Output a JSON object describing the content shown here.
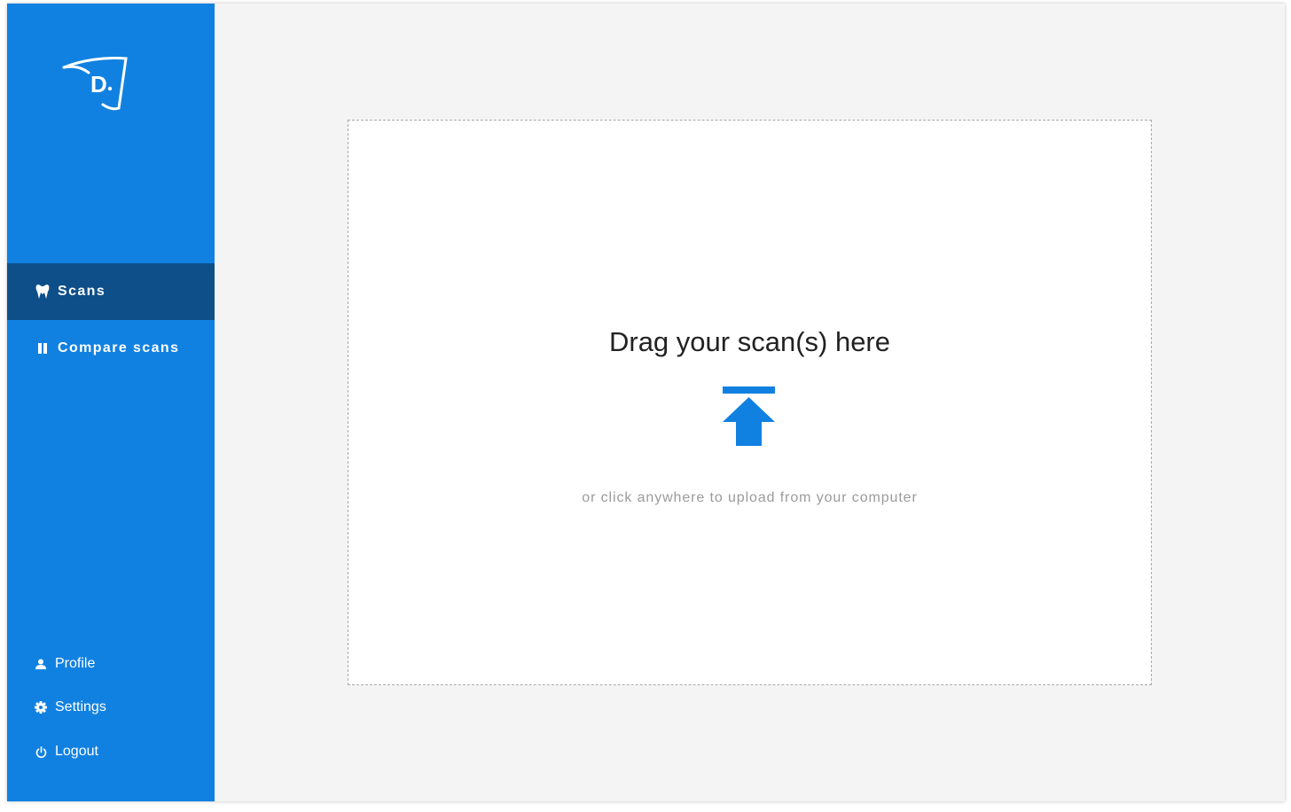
{
  "colors": {
    "sidebar_bg": "#1181e1",
    "sidebar_active": "#0e4f89",
    "accent": "#1181e1",
    "content_bg": "#f4f4f4"
  },
  "sidebar": {
    "logo": "D",
    "nav": [
      {
        "label": "Scans",
        "icon": "tooth-icon",
        "active": true
      },
      {
        "label": "Compare scans",
        "icon": "columns-icon",
        "active": false
      }
    ],
    "bottom": [
      {
        "label": "Profile",
        "icon": "person-icon"
      },
      {
        "label": "Settings",
        "icon": "gear-icon"
      },
      {
        "label": "Logout",
        "icon": "power-icon"
      }
    ]
  },
  "dropzone": {
    "title": "Drag your scan(s) here",
    "subtitle": "or click anywhere to upload from your computer",
    "icon": "upload-icon"
  }
}
